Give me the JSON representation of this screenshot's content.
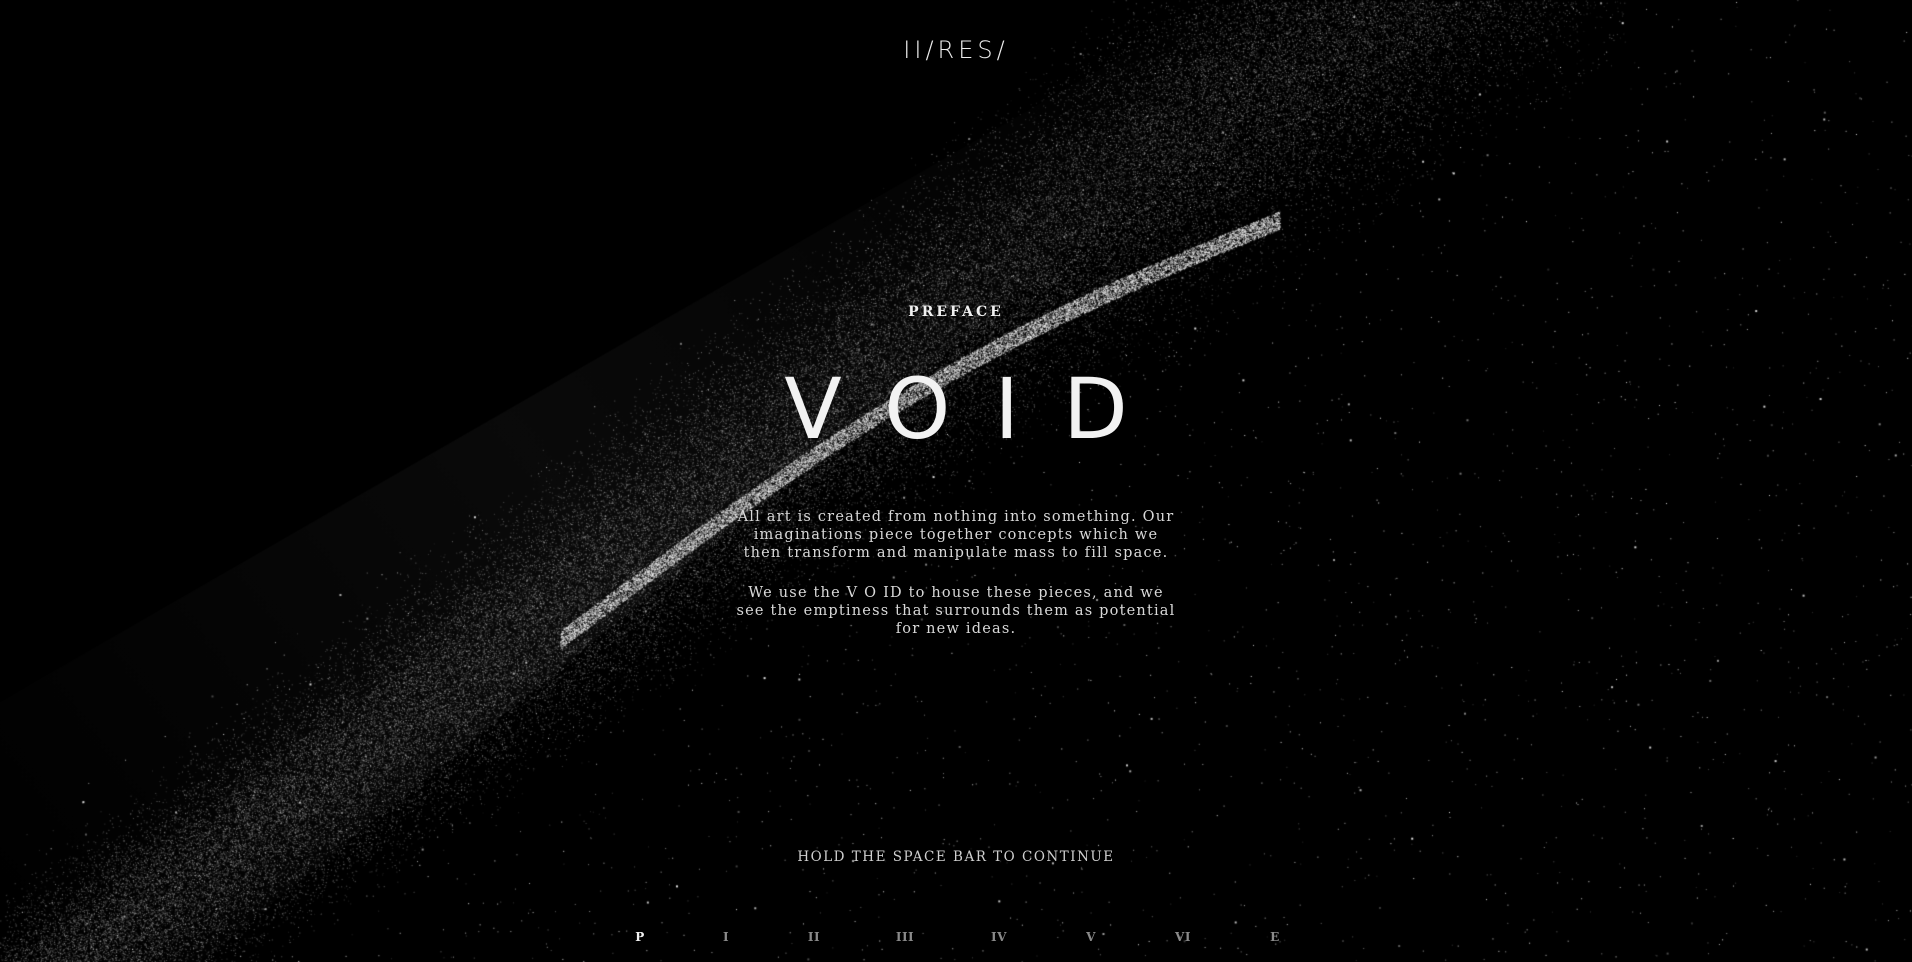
{
  "logo": {
    "text": "II/RES/"
  },
  "preface": {
    "kicker": "PREFACE",
    "title": "VOID",
    "paragraphs": [
      "All art is created from nothing into something. Our imaginations piece together concepts which we then transform and manipulate mass to fill space.",
      "We use the V O ID to house these pieces, and we see the emptiness that surrounds them as potential for new ideas."
    ]
  },
  "hint": "HOLD THE SPACE BAR TO CONTINUE",
  "chapters": [
    {
      "label": "P",
      "active": true
    },
    {
      "label": "I",
      "active": false
    },
    {
      "label": "II",
      "active": false
    },
    {
      "label": "III",
      "active": false
    },
    {
      "label": "IV",
      "active": false
    },
    {
      "label": "V",
      "active": false
    },
    {
      "label": "VI",
      "active": false
    },
    {
      "label": "E",
      "active": false
    }
  ],
  "colors": {
    "background": "#000000",
    "text": "#e6e6e6",
    "inactive_chapter": "#8a8a8a"
  }
}
